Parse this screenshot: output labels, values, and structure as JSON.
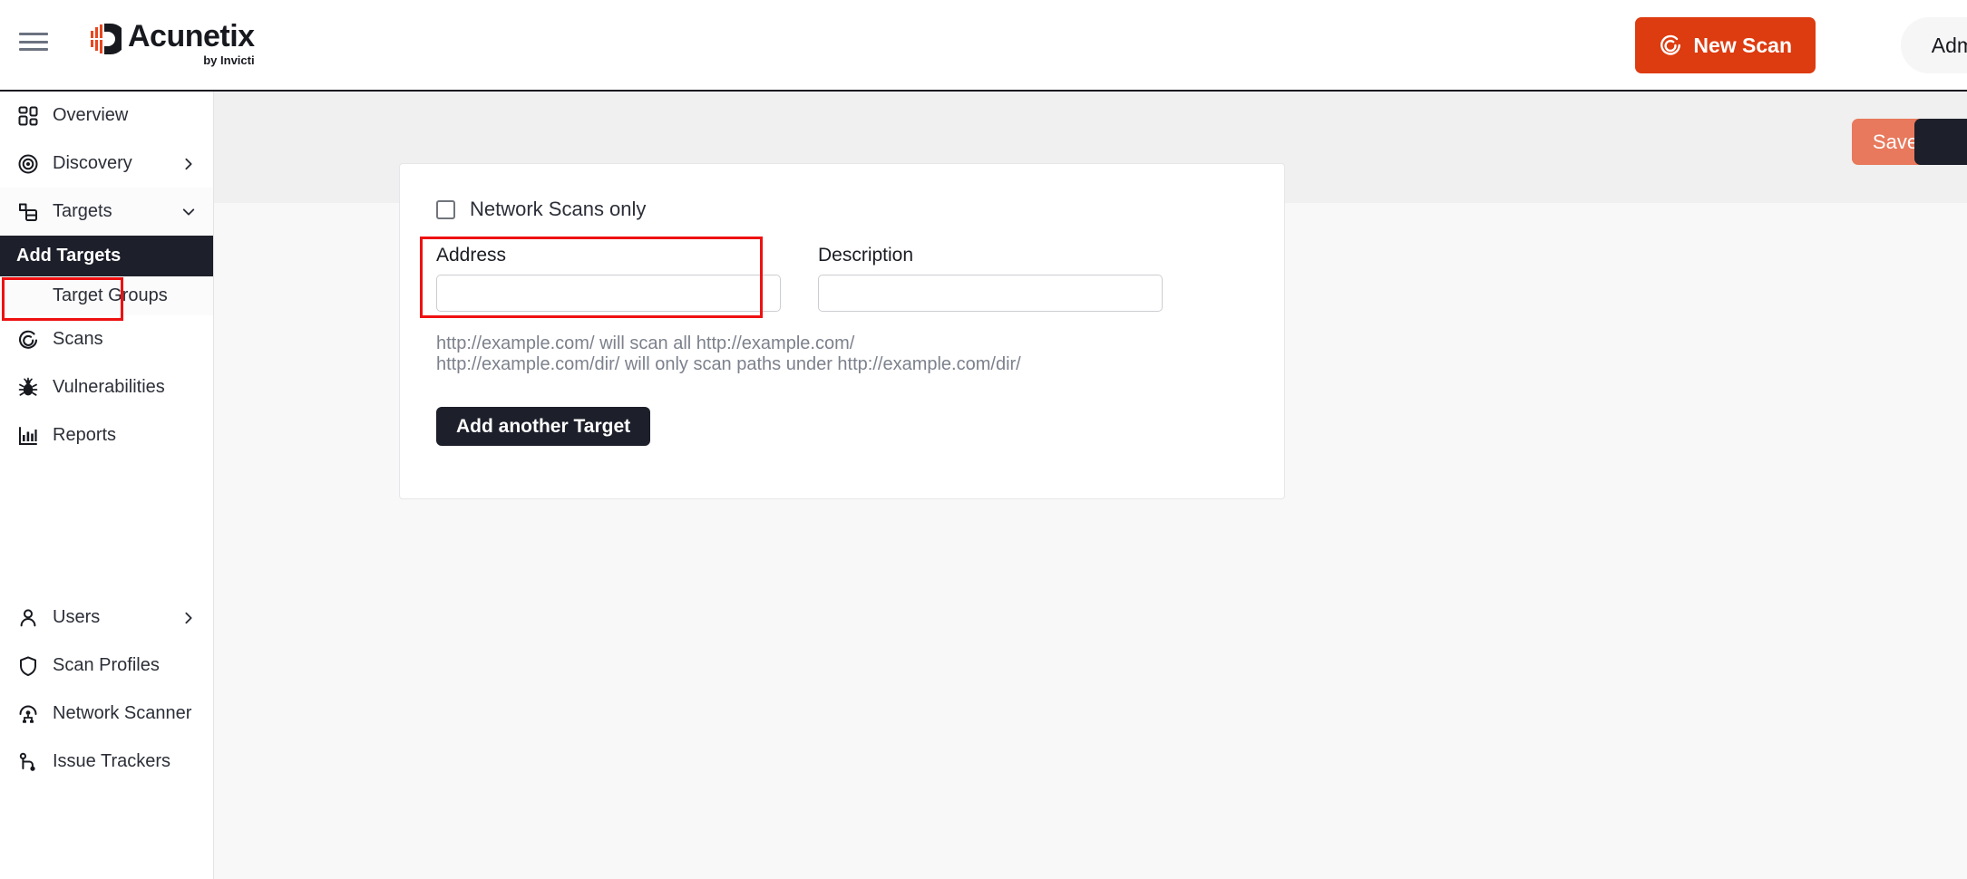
{
  "header": {
    "menu_icon": "hamburger-menu-icon",
    "brand": {
      "name": "Acunetix",
      "tagline": "by Invicti",
      "logo_icon": "acunetix-logo-icon"
    },
    "new_scan_label": "New Scan",
    "new_scan_icon": "scan-icon",
    "account_label": "Admin",
    "accent_color": "#dd3b10"
  },
  "sidebar": {
    "items": [
      {
        "label": "Overview",
        "icon": "grid-icon",
        "has_chevron": false,
        "chevron": ""
      },
      {
        "label": "Discovery",
        "icon": "target-circle-icon",
        "has_chevron": true,
        "chevron": "right"
      },
      {
        "label": "Targets",
        "icon": "targets-stack-icon",
        "has_chevron": true,
        "chevron": "down"
      },
      {
        "label": "Scans",
        "icon": "scan-icon",
        "has_chevron": false,
        "chevron": ""
      },
      {
        "label": "Vulnerabilities",
        "icon": "bug-icon",
        "has_chevron": false,
        "chevron": ""
      },
      {
        "label": "Reports",
        "icon": "bar-chart-icon",
        "has_chevron": false,
        "chevron": ""
      }
    ],
    "targets_children": [
      {
        "label": "Add Targets",
        "active": true
      },
      {
        "label": "Target Groups",
        "active": false
      }
    ],
    "bottom_items": [
      {
        "label": "Users",
        "icon": "user-icon",
        "has_chevron": true,
        "chevron": "right"
      },
      {
        "label": "Scan Profiles",
        "icon": "shield-icon",
        "has_chevron": false,
        "chevron": ""
      },
      {
        "label": "Network Scanner",
        "icon": "network-node-icon",
        "has_chevron": false,
        "chevron": ""
      },
      {
        "label": "Issue Trackers",
        "icon": "issue-tracker-icon",
        "has_chevron": false,
        "chevron": ""
      }
    ],
    "active_highlight_color": "#ee1111"
  },
  "toolbar": {
    "save_label": "Save",
    "secondary_label": "",
    "save_color": "#e8795c"
  },
  "form": {
    "network_scans_only": {
      "label": "Network Scans only",
      "checked": false
    },
    "address": {
      "label": "Address",
      "value": "",
      "placeholder": "",
      "highlighted": true
    },
    "description": {
      "label": "Description",
      "value": "",
      "placeholder": ""
    },
    "hint_line_1": "http://example.com/ will scan all http://example.com/",
    "hint_line_2": "http://example.com/dir/ will only scan paths under http://example.com/dir/",
    "add_another_label": "Add another Target"
  }
}
